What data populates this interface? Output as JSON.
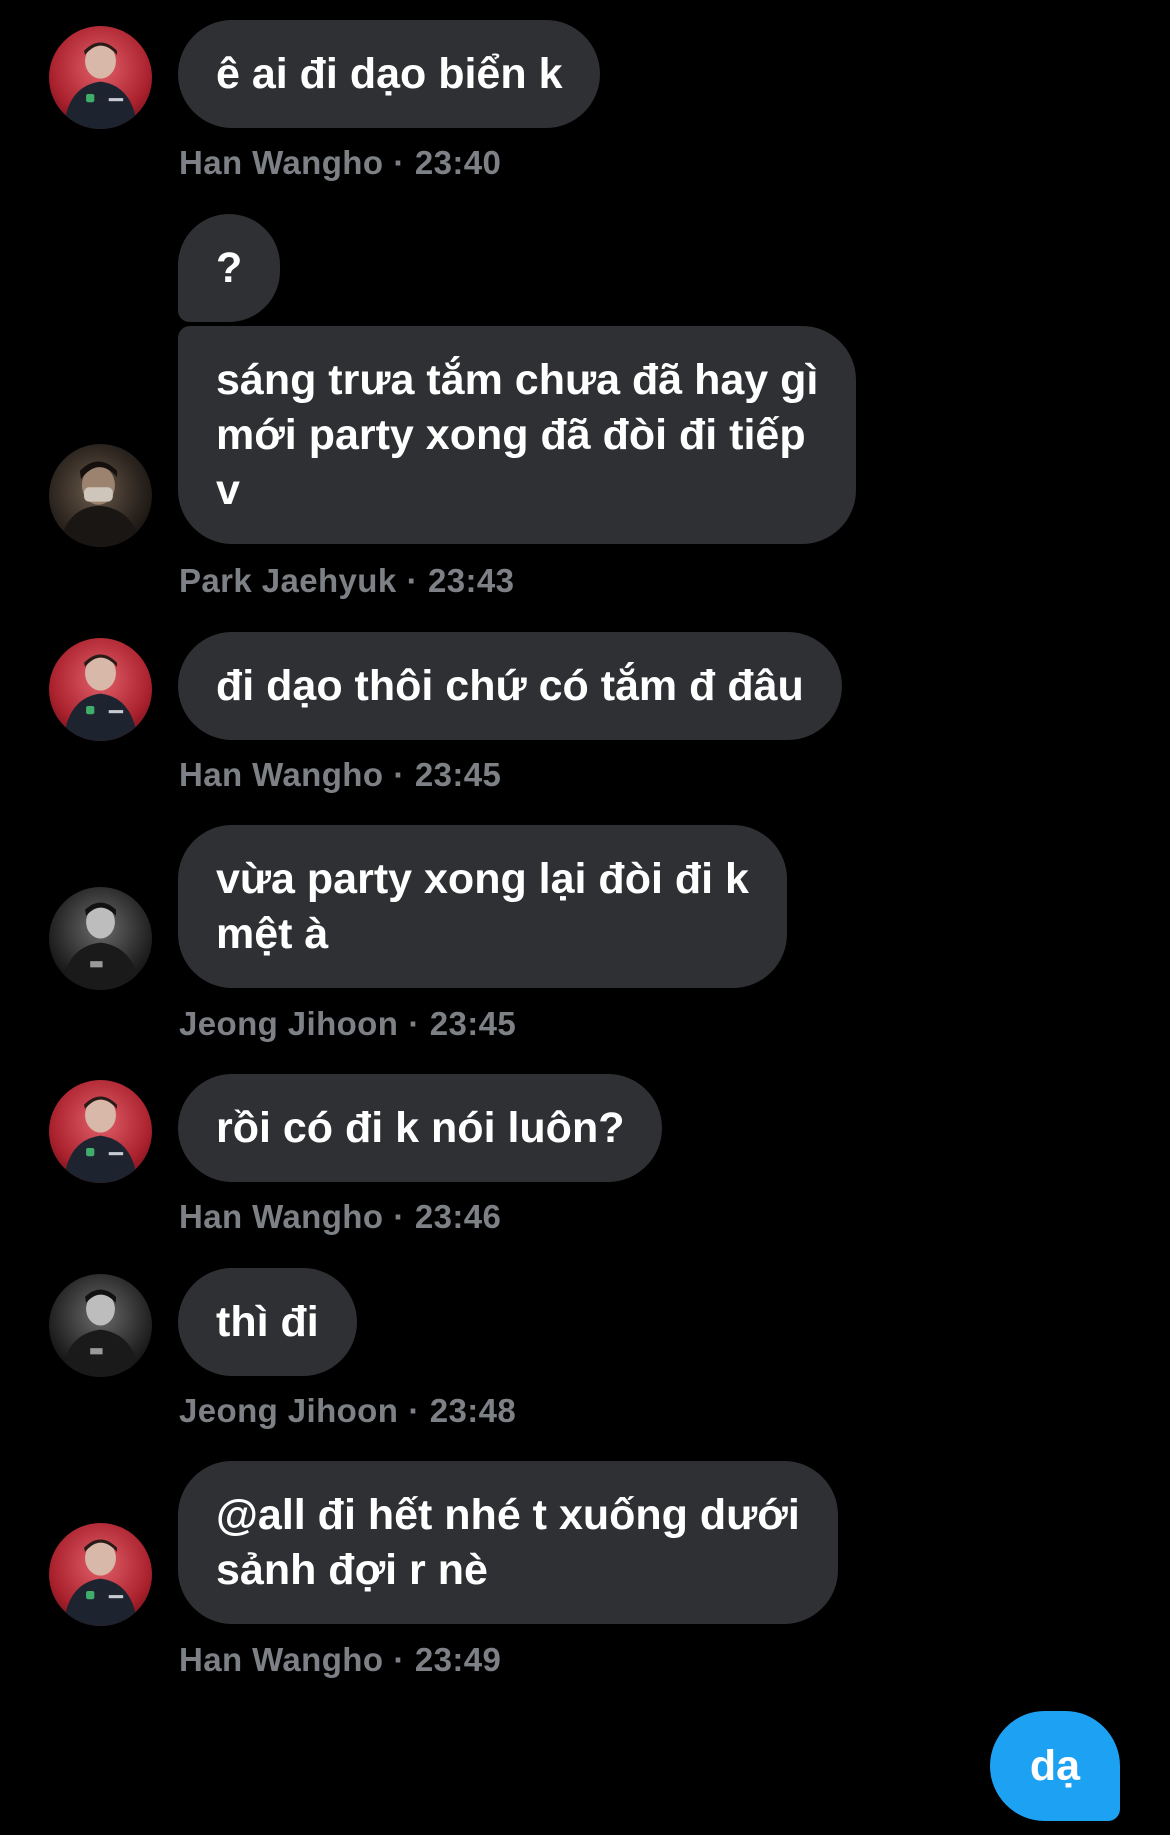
{
  "messages": [
    {
      "sender": "Han Wangho",
      "time": "23:40",
      "texts": [
        "ê ai đi dạo biển k"
      ]
    },
    {
      "sender": "Park Jaehyuk",
      "time": "23:43",
      "texts": [
        "?",
        "sáng trưa tắm chưa đã hay gì\nmới party xong đã đòi đi tiếp\nv"
      ]
    },
    {
      "sender": "Han Wangho",
      "time": "23:45",
      "texts": [
        "đi dạo thôi chứ có tắm đ đâu"
      ]
    },
    {
      "sender": "Jeong Jihoon",
      "time": "23:45",
      "texts": [
        "vừa party xong lại đòi đi k\nmệt à"
      ]
    },
    {
      "sender": "Han Wangho",
      "time": "23:46",
      "texts": [
        "rồi có đi k nói luôn?"
      ]
    },
    {
      "sender": "Jeong Jihoon",
      "time": "23:48",
      "texts": [
        "thì đi"
      ]
    },
    {
      "sender": "Han Wangho",
      "time": "23:49",
      "texts": [
        "@all đi hết nhé t xuống dưới\nsảnh đợi r nè"
      ]
    }
  ],
  "separator": "·",
  "own_message": {
    "text": "dạ"
  },
  "colors": {
    "background": "#000000",
    "bubble": "#2f3033",
    "meta_text": "#7d8186",
    "own_bubble": "#1da1f2"
  },
  "icons": {
    "han_wangho_avatar": "avatar-han-wangho",
    "park_jaehyuk_avatar": "avatar-park-jaehyuk",
    "jeong_jihoon_avatar": "avatar-jeong-jihoon"
  }
}
